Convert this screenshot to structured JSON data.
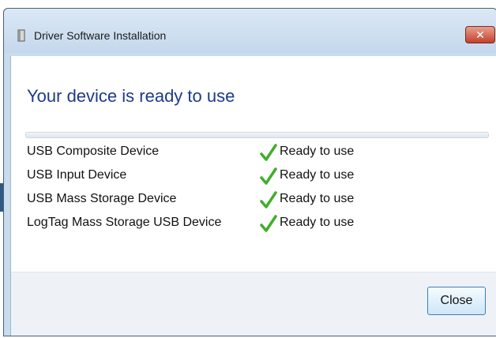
{
  "window": {
    "title": "Driver Software Installation",
    "close_glyph": "✕"
  },
  "main": {
    "heading": "Your device is ready to use",
    "devices": [
      {
        "name": "USB Composite Device",
        "status": "Ready to use",
        "status_icon": "green-checkmark"
      },
      {
        "name": "USB Input Device",
        "status": "Ready to use",
        "status_icon": "green-checkmark"
      },
      {
        "name": "USB Mass Storage Device",
        "status": "Ready to use",
        "status_icon": "green-checkmark"
      },
      {
        "name": "LogTag Mass Storage USB Device",
        "status": "Ready to use",
        "status_icon": "green-checkmark"
      }
    ]
  },
  "footer": {
    "close_label": "Close"
  },
  "colors": {
    "heading": "#1c3a8f",
    "check": "#3fae2a",
    "window_close": "#c2412c"
  }
}
